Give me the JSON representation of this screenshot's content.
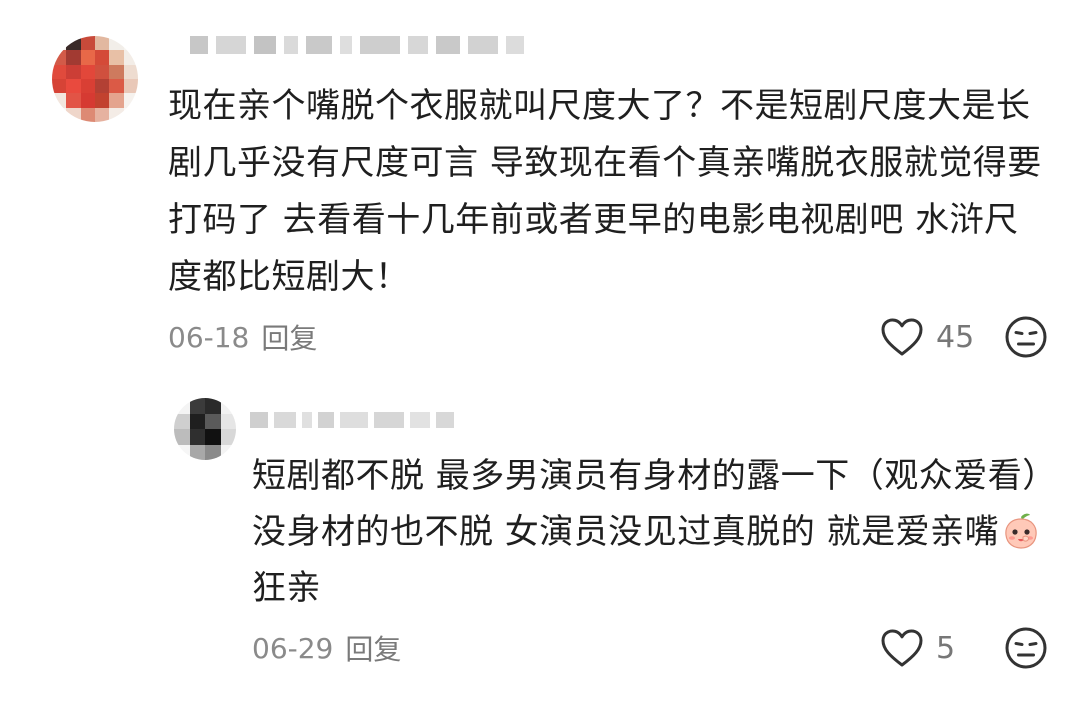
{
  "comment": {
    "text": "现在亲个嘴脱个衣服就叫尺度大了？不是短剧尺度大是长剧几乎没有尺度可言 导致现在看个真亲嘴脱衣服就觉得要打码了 去看看十几年前或者更早的电影电视剧吧 水浒尺度都比短剧大！",
    "date": "06-18",
    "reply_label": "回复",
    "like_count": "45",
    "like_icon": "heart-outline-icon",
    "dislike_icon": "meh-face-icon"
  },
  "reply": {
    "text_part1": "短剧都不脱 最多男演员有身材的露一下（观众爱看）没身材的也不脱 女演员没见过真脱的 就是爱亲嘴",
    "emoji": "peach-face-emoji",
    "text_part2": "狂亲",
    "date": "06-29",
    "reply_label": "回复",
    "like_count": "5",
    "like_icon": "heart-outline-icon",
    "dislike_icon": "meh-face-icon"
  },
  "colors": {
    "text_primary": "#1f1f1f",
    "text_secondary": "#8a8a8a",
    "icon_gray": "#333333"
  }
}
